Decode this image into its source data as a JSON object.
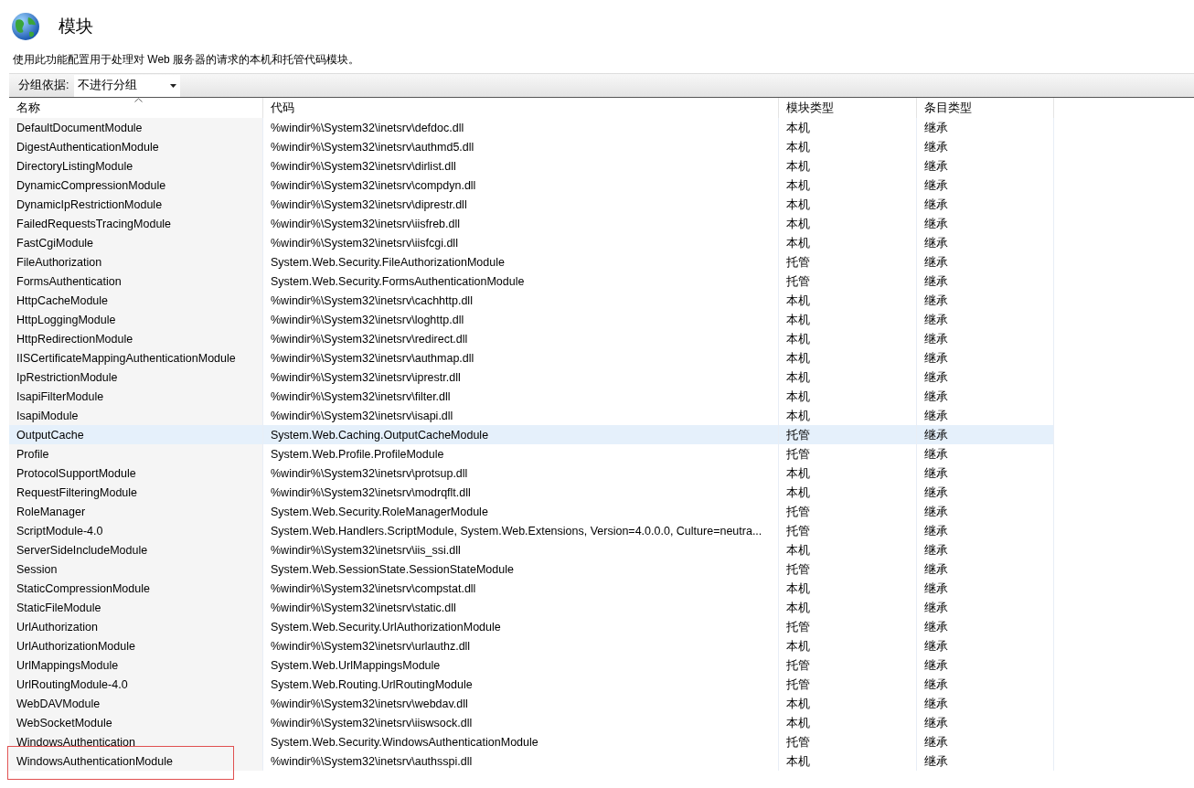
{
  "header": {
    "title": "模块",
    "description": "使用此功能配置用于处理对 Web 服务器的请求的本机和托管代码模块。"
  },
  "toolbar": {
    "group_label": "分组依据:",
    "group_value": "不进行分组"
  },
  "table": {
    "columns": [
      {
        "label": "名称",
        "sorted": true
      },
      {
        "label": "代码",
        "sorted": false
      },
      {
        "label": "模块类型",
        "sorted": false
      },
      {
        "label": "条目类型",
        "sorted": false
      }
    ],
    "rows": [
      {
        "name": "DefaultDocumentModule",
        "code": "%windir%\\System32\\inetsrv\\defdoc.dll",
        "module_type": "本机",
        "entry_type": "继承",
        "selected": false,
        "outlined": false
      },
      {
        "name": "DigestAuthenticationModule",
        "code": "%windir%\\System32\\inetsrv\\authmd5.dll",
        "module_type": "本机",
        "entry_type": "继承",
        "selected": false,
        "outlined": false
      },
      {
        "name": "DirectoryListingModule",
        "code": "%windir%\\System32\\inetsrv\\dirlist.dll",
        "module_type": "本机",
        "entry_type": "继承",
        "selected": false,
        "outlined": false
      },
      {
        "name": "DynamicCompressionModule",
        "code": "%windir%\\System32\\inetsrv\\compdyn.dll",
        "module_type": "本机",
        "entry_type": "继承",
        "selected": false,
        "outlined": false
      },
      {
        "name": "DynamicIpRestrictionModule",
        "code": "%windir%\\System32\\inetsrv\\diprestr.dll",
        "module_type": "本机",
        "entry_type": "继承",
        "selected": false,
        "outlined": false
      },
      {
        "name": "FailedRequestsTracingModule",
        "code": "%windir%\\System32\\inetsrv\\iisfreb.dll",
        "module_type": "本机",
        "entry_type": "继承",
        "selected": false,
        "outlined": false
      },
      {
        "name": "FastCgiModule",
        "code": "%windir%\\System32\\inetsrv\\iisfcgi.dll",
        "module_type": "本机",
        "entry_type": "继承",
        "selected": false,
        "outlined": false
      },
      {
        "name": "FileAuthorization",
        "code": "System.Web.Security.FileAuthorizationModule",
        "module_type": "托管",
        "entry_type": "继承",
        "selected": false,
        "outlined": false
      },
      {
        "name": "FormsAuthentication",
        "code": "System.Web.Security.FormsAuthenticationModule",
        "module_type": "托管",
        "entry_type": "继承",
        "selected": false,
        "outlined": false
      },
      {
        "name": "HttpCacheModule",
        "code": "%windir%\\System32\\inetsrv\\cachhttp.dll",
        "module_type": "本机",
        "entry_type": "继承",
        "selected": false,
        "outlined": false
      },
      {
        "name": "HttpLoggingModule",
        "code": "%windir%\\System32\\inetsrv\\loghttp.dll",
        "module_type": "本机",
        "entry_type": "继承",
        "selected": false,
        "outlined": false
      },
      {
        "name": "HttpRedirectionModule",
        "code": "%windir%\\System32\\inetsrv\\redirect.dll",
        "module_type": "本机",
        "entry_type": "继承",
        "selected": false,
        "outlined": false
      },
      {
        "name": "IISCertificateMappingAuthenticationModule",
        "code": "%windir%\\System32\\inetsrv\\authmap.dll",
        "module_type": "本机",
        "entry_type": "继承",
        "selected": false,
        "outlined": false
      },
      {
        "name": "IpRestrictionModule",
        "code": "%windir%\\System32\\inetsrv\\iprestr.dll",
        "module_type": "本机",
        "entry_type": "继承",
        "selected": false,
        "outlined": false
      },
      {
        "name": "IsapiFilterModule",
        "code": "%windir%\\System32\\inetsrv\\filter.dll",
        "module_type": "本机",
        "entry_type": "继承",
        "selected": false,
        "outlined": false
      },
      {
        "name": "IsapiModule",
        "code": "%windir%\\System32\\inetsrv\\isapi.dll",
        "module_type": "本机",
        "entry_type": "继承",
        "selected": false,
        "outlined": false
      },
      {
        "name": "OutputCache",
        "code": "System.Web.Caching.OutputCacheModule",
        "module_type": "托管",
        "entry_type": "继承",
        "selected": true,
        "outlined": false
      },
      {
        "name": "Profile",
        "code": "System.Web.Profile.ProfileModule",
        "module_type": "托管",
        "entry_type": "继承",
        "selected": false,
        "outlined": false
      },
      {
        "name": "ProtocolSupportModule",
        "code": "%windir%\\System32\\inetsrv\\protsup.dll",
        "module_type": "本机",
        "entry_type": "继承",
        "selected": false,
        "outlined": false
      },
      {
        "name": "RequestFilteringModule",
        "code": "%windir%\\System32\\inetsrv\\modrqflt.dll",
        "module_type": "本机",
        "entry_type": "继承",
        "selected": false,
        "outlined": false
      },
      {
        "name": "RoleManager",
        "code": "System.Web.Security.RoleManagerModule",
        "module_type": "托管",
        "entry_type": "继承",
        "selected": false,
        "outlined": false
      },
      {
        "name": "ScriptModule-4.0",
        "code": "System.Web.Handlers.ScriptModule, System.Web.Extensions, Version=4.0.0.0, Culture=neutra...",
        "module_type": "托管",
        "entry_type": "继承",
        "selected": false,
        "outlined": false
      },
      {
        "name": "ServerSideIncludeModule",
        "code": "%windir%\\System32\\inetsrv\\iis_ssi.dll",
        "module_type": "本机",
        "entry_type": "继承",
        "selected": false,
        "outlined": false
      },
      {
        "name": "Session",
        "code": "System.Web.SessionState.SessionStateModule",
        "module_type": "托管",
        "entry_type": "继承",
        "selected": false,
        "outlined": false
      },
      {
        "name": "StaticCompressionModule",
        "code": "%windir%\\System32\\inetsrv\\compstat.dll",
        "module_type": "本机",
        "entry_type": "继承",
        "selected": false,
        "outlined": false
      },
      {
        "name": "StaticFileModule",
        "code": "%windir%\\System32\\inetsrv\\static.dll",
        "module_type": "本机",
        "entry_type": "继承",
        "selected": false,
        "outlined": false
      },
      {
        "name": "UrlAuthorization",
        "code": "System.Web.Security.UrlAuthorizationModule",
        "module_type": "托管",
        "entry_type": "继承",
        "selected": false,
        "outlined": false
      },
      {
        "name": "UrlAuthorizationModule",
        "code": "%windir%\\System32\\inetsrv\\urlauthz.dll",
        "module_type": "本机",
        "entry_type": "继承",
        "selected": false,
        "outlined": false
      },
      {
        "name": "UrlMappingsModule",
        "code": "System.Web.UrlMappingsModule",
        "module_type": "托管",
        "entry_type": "继承",
        "selected": false,
        "outlined": false
      },
      {
        "name": "UrlRoutingModule-4.0",
        "code": "System.Web.Routing.UrlRoutingModule",
        "module_type": "托管",
        "entry_type": "继承",
        "selected": false,
        "outlined": false
      },
      {
        "name": "WebDAVModule",
        "code": "%windir%\\System32\\inetsrv\\webdav.dll",
        "module_type": "本机",
        "entry_type": "继承",
        "selected": false,
        "outlined": false
      },
      {
        "name": "WebSocketModule",
        "code": "%windir%\\System32\\inetsrv\\iiswsock.dll",
        "module_type": "本机",
        "entry_type": "继承",
        "selected": false,
        "outlined": false
      },
      {
        "name": "WindowsAuthentication",
        "code": "System.Web.Security.WindowsAuthenticationModule",
        "module_type": "托管",
        "entry_type": "继承",
        "selected": false,
        "outlined": false
      },
      {
        "name": "WindowsAuthenticationModule",
        "code": "%windir%\\System32\\inetsrv\\authsspi.dll",
        "module_type": "本机",
        "entry_type": "继承",
        "selected": false,
        "outlined": true
      }
    ]
  }
}
